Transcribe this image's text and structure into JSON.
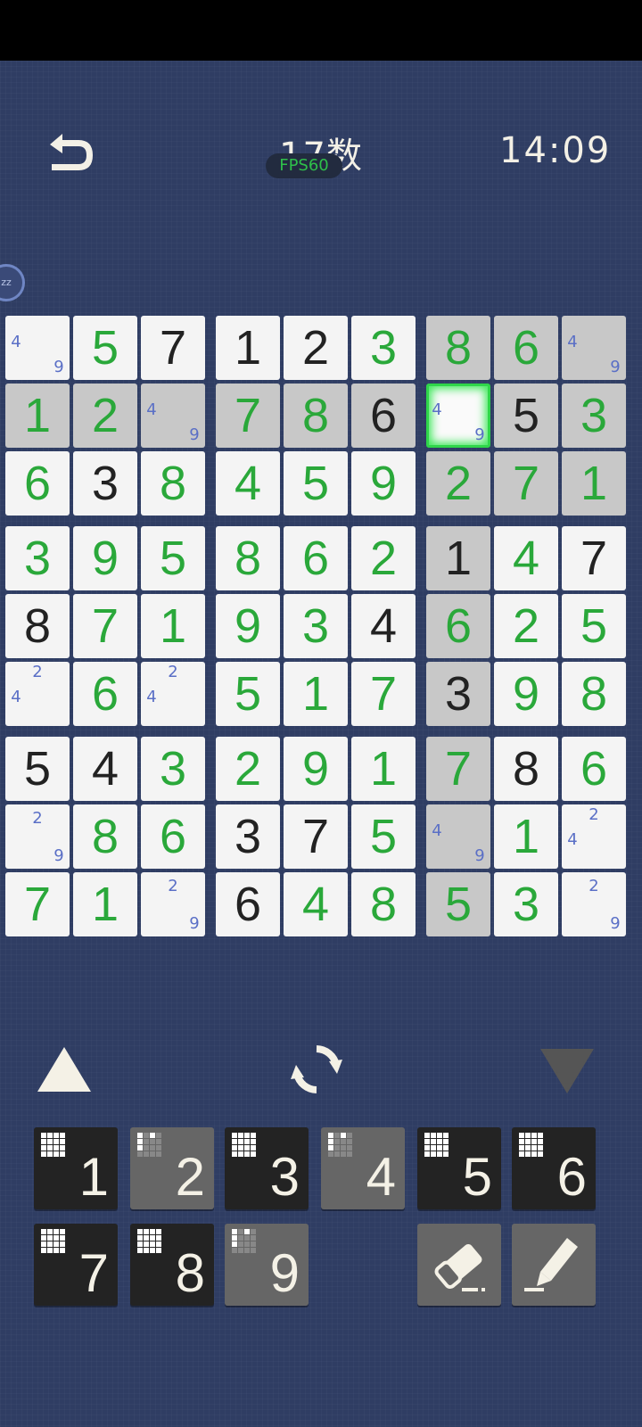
{
  "header": {
    "title": "17数",
    "fps": "FPS60",
    "timer": "14:09",
    "sleep_badge": "zz"
  },
  "colors": {
    "background": "#2f3d63",
    "user_digit": "#2aa83a",
    "given_digit": "#222222",
    "note": "#5a6fc6",
    "selection": "#2fd64a"
  },
  "board": {
    "rows": [
      [
        {
          "n": "",
          "notes": [
            "4",
            "9"
          ]
        },
        {
          "v": "5",
          "u": 1
        },
        {
          "v": "7"
        },
        {
          "v": "1"
        },
        {
          "v": "2"
        },
        {
          "v": "3",
          "u": 1
        },
        {
          "v": "8",
          "u": 1,
          "h": 1
        },
        {
          "v": "6",
          "u": 1,
          "h": 1
        },
        {
          "n": "",
          "notes": [
            "4",
            "9"
          ],
          "h": 1
        }
      ],
      [
        {
          "v": "1",
          "u": 1,
          "h": 1
        },
        {
          "v": "2",
          "u": 1,
          "h": 1
        },
        {
          "n": "",
          "notes": [
            "4",
            "9"
          ],
          "h": 1
        },
        {
          "v": "7",
          "u": 1,
          "h": 1
        },
        {
          "v": "8",
          "u": 1,
          "h": 1
        },
        {
          "v": "6",
          "h": 1
        },
        {
          "n": "",
          "notes": [
            "4",
            "9"
          ],
          "sel": 1
        },
        {
          "v": "5",
          "h": 1
        },
        {
          "v": "3",
          "u": 1,
          "h": 1
        }
      ],
      [
        {
          "v": "6",
          "u": 1
        },
        {
          "v": "3"
        },
        {
          "v": "8",
          "u": 1
        },
        {
          "v": "4",
          "u": 1
        },
        {
          "v": "5",
          "u": 1
        },
        {
          "v": "9",
          "u": 1
        },
        {
          "v": "2",
          "u": 1,
          "h": 1
        },
        {
          "v": "7",
          "u": 1,
          "h": 1
        },
        {
          "v": "1",
          "u": 1,
          "h": 1
        }
      ],
      [
        {
          "v": "3",
          "u": 1
        },
        {
          "v": "9",
          "u": 1
        },
        {
          "v": "5",
          "u": 1
        },
        {
          "v": "8",
          "u": 1
        },
        {
          "v": "6",
          "u": 1
        },
        {
          "v": "2",
          "u": 1
        },
        {
          "v": "1",
          "h": 1
        },
        {
          "v": "4",
          "u": 1
        },
        {
          "v": "7"
        }
      ],
      [
        {
          "v": "8"
        },
        {
          "v": "7",
          "u": 1
        },
        {
          "v": "1",
          "u": 1
        },
        {
          "v": "9",
          "u": 1
        },
        {
          "v": "3",
          "u": 1
        },
        {
          "v": "4"
        },
        {
          "v": "6",
          "u": 1,
          "h": 1
        },
        {
          "v": "2",
          "u": 1
        },
        {
          "v": "5",
          "u": 1
        }
      ],
      [
        {
          "n": "",
          "notes": [
            "4",
            "2"
          ],
          "t": "42"
        },
        {
          "v": "6",
          "u": 1
        },
        {
          "n": "",
          "notes": [
            "4",
            "2"
          ],
          "t": "42"
        },
        {
          "v": "5",
          "u": 1
        },
        {
          "v": "1",
          "u": 1
        },
        {
          "v": "7",
          "u": 1
        },
        {
          "v": "3",
          "h": 1
        },
        {
          "v": "9",
          "u": 1
        },
        {
          "v": "8",
          "u": 1
        }
      ],
      [
        {
          "v": "5"
        },
        {
          "v": "4"
        },
        {
          "v": "3",
          "u": 1
        },
        {
          "v": "2",
          "u": 1
        },
        {
          "v": "9",
          "u": 1
        },
        {
          "v": "1",
          "u": 1
        },
        {
          "v": "7",
          "u": 1,
          "h": 1
        },
        {
          "v": "8"
        },
        {
          "v": "6",
          "u": 1
        }
      ],
      [
        {
          "n": "",
          "notes": [
            "2",
            "9"
          ],
          "t": "29"
        },
        {
          "v": "8",
          "u": 1
        },
        {
          "v": "6",
          "u": 1
        },
        {
          "v": "3"
        },
        {
          "v": "7"
        },
        {
          "v": "5",
          "u": 1
        },
        {
          "n": "",
          "notes": [
            "4",
            "9"
          ],
          "h": 1
        },
        {
          "v": "1",
          "u": 1
        },
        {
          "n": "",
          "notes": [
            "4",
            "2"
          ],
          "t": "42"
        }
      ],
      [
        {
          "v": "7",
          "u": 1
        },
        {
          "v": "1",
          "u": 1
        },
        {
          "n": "",
          "notes": [
            "2",
            "9"
          ],
          "t": "29"
        },
        {
          "v": "6"
        },
        {
          "v": "4",
          "u": 1
        },
        {
          "v": "8",
          "u": 1
        },
        {
          "v": "5",
          "u": 1,
          "h": 1
        },
        {
          "v": "3",
          "u": 1
        },
        {
          "n": "",
          "notes": [
            "2",
            "9"
          ],
          "t": "29"
        }
      ]
    ]
  },
  "number_buttons": [
    {
      "label": "1",
      "style": "dark",
      "dim": []
    },
    {
      "label": "2",
      "style": "light",
      "dim": [
        0,
        1,
        2,
        3,
        4,
        5,
        6,
        7,
        8,
        9,
        10,
        11,
        12,
        13,
        14,
        15
      ]
    },
    {
      "label": "3",
      "style": "dark",
      "dim": []
    },
    {
      "label": "4",
      "style": "light",
      "dim": [
        0,
        1,
        2,
        3,
        4,
        5,
        6,
        7,
        8,
        9,
        10,
        11,
        12,
        13,
        14,
        15
      ]
    },
    {
      "label": "5",
      "style": "dark",
      "dim": []
    },
    {
      "label": "6",
      "style": "dark",
      "dim": []
    },
    {
      "label": "7",
      "style": "dark",
      "dim": []
    },
    {
      "label": "8",
      "style": "dark",
      "dim": []
    },
    {
      "label": "9",
      "style": "light",
      "dim": [
        0,
        1,
        2,
        3,
        4,
        5,
        6,
        7,
        8,
        9,
        10,
        11,
        12,
        13,
        14,
        15
      ]
    }
  ],
  "icons": {
    "back": "back-arrow-icon",
    "prev": "triangle-up-icon",
    "refresh": "refresh-icon",
    "next": "triangle-down-icon",
    "eraser": "eraser-icon",
    "pencil": "pencil-icon"
  }
}
